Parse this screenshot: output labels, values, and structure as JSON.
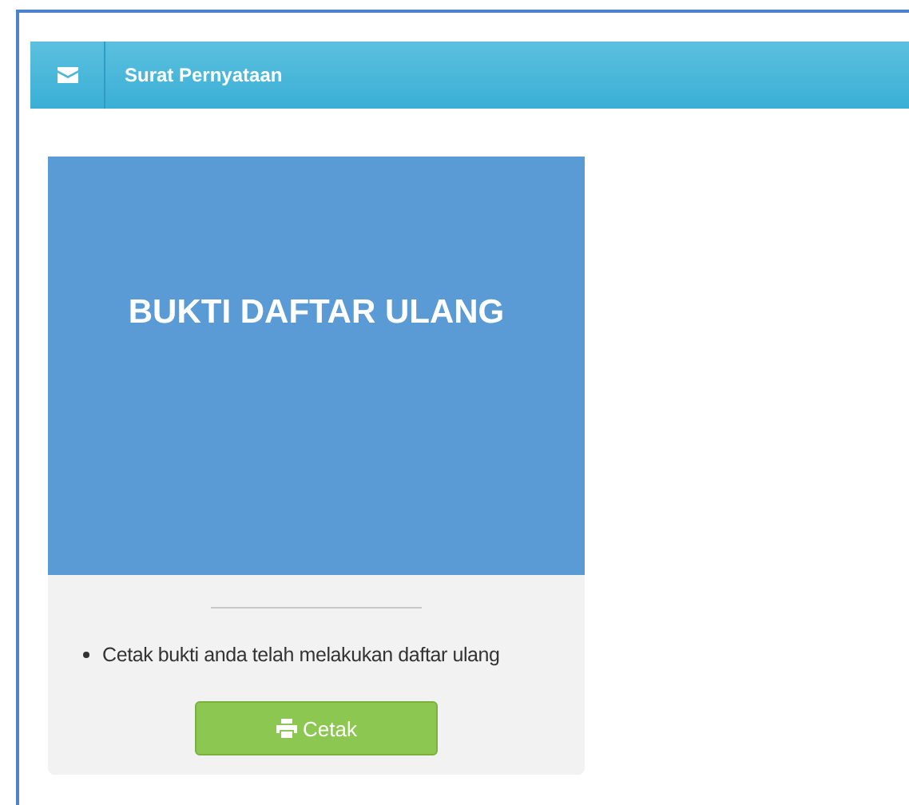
{
  "panel": {
    "title": "Surat Pernyataan"
  },
  "card": {
    "heading": "BUKTI DAFTAR ULANG",
    "items": [
      "Cetak bukti anda telah melakukan daftar ulang"
    ],
    "button": "Cetak"
  }
}
